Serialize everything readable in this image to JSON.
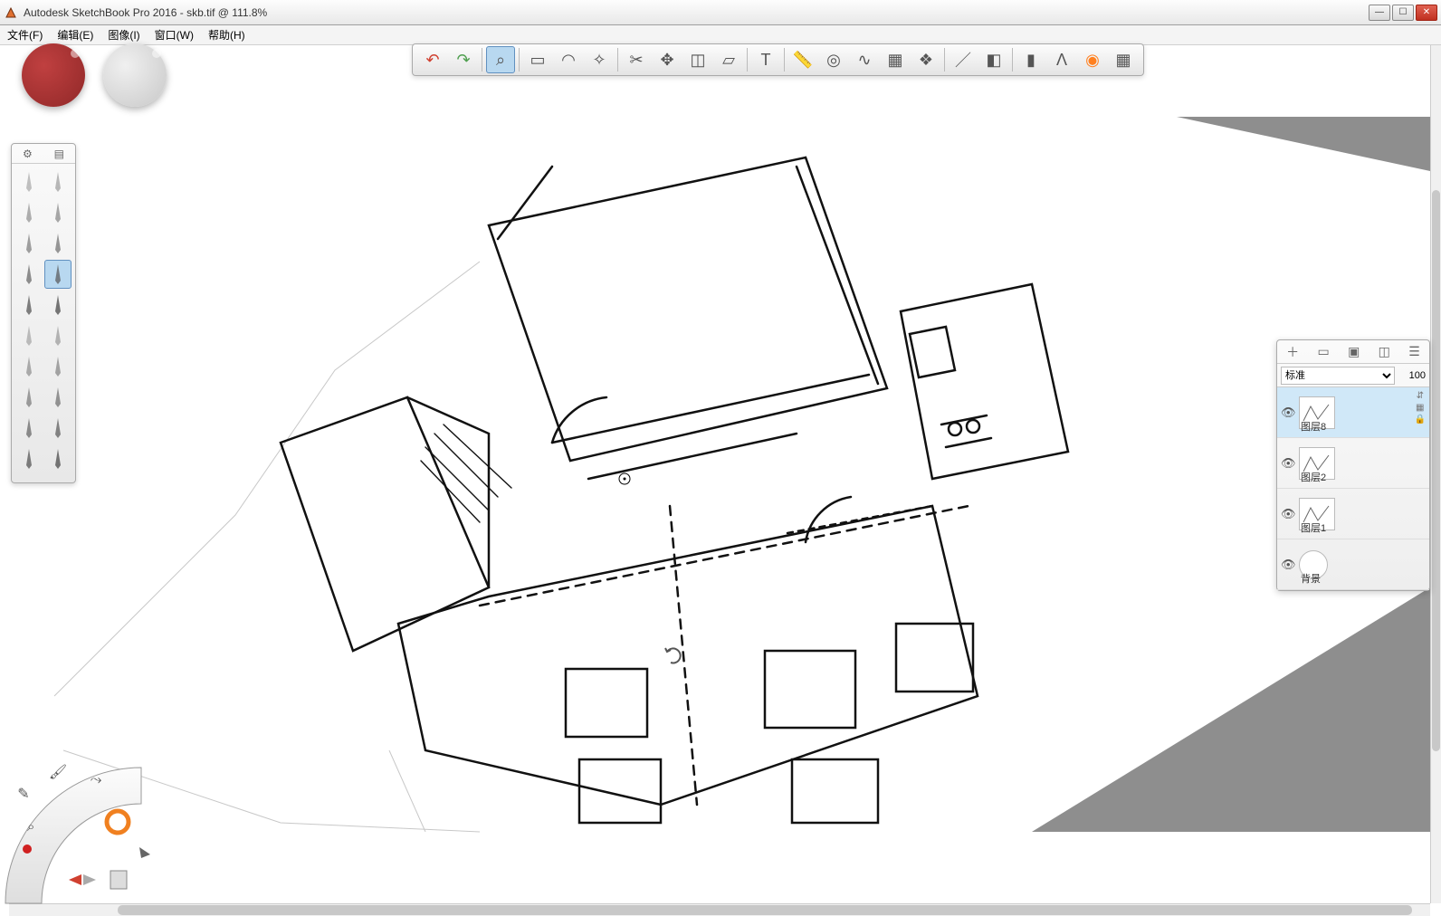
{
  "app": {
    "title": "Autodesk SketchBook Pro 2016 - skb.tif @ 111.8%",
    "icon_name": "sketchbook-app-icon"
  },
  "menus": [
    {
      "label": "文件(F)"
    },
    {
      "label": "编辑(E)"
    },
    {
      "label": "图像(I)"
    },
    {
      "label": "窗口(W)"
    },
    {
      "label": "帮助(H)"
    }
  ],
  "top_toolbar": [
    {
      "name": "undo",
      "icon": "↶",
      "color": "#d04030"
    },
    {
      "name": "redo",
      "icon": "↷",
      "color": "#50a050"
    },
    {
      "sep": true
    },
    {
      "name": "zoom",
      "icon": "⌕",
      "active": true
    },
    {
      "sep": true
    },
    {
      "name": "marquee-rect",
      "icon": "▭"
    },
    {
      "name": "marquee-lasso",
      "icon": "◠"
    },
    {
      "name": "marquee-magic",
      "icon": "✧"
    },
    {
      "sep": true
    },
    {
      "name": "crop",
      "icon": "✂"
    },
    {
      "name": "transform-move",
      "icon": "✥"
    },
    {
      "name": "transform-free",
      "icon": "◫"
    },
    {
      "name": "transform-distort",
      "icon": "▱"
    },
    {
      "sep": true
    },
    {
      "name": "text",
      "icon": "T"
    },
    {
      "sep": true
    },
    {
      "name": "ruler",
      "icon": "📏"
    },
    {
      "name": "ellipse-guide",
      "icon": "◎"
    },
    {
      "name": "french-curve",
      "icon": "∿"
    },
    {
      "name": "perspective",
      "icon": "▦"
    },
    {
      "name": "symmetry",
      "icon": "❖"
    },
    {
      "sep": true
    },
    {
      "name": "line-stroke",
      "icon": "／"
    },
    {
      "name": "shapes",
      "icon": "◧"
    },
    {
      "sep": true
    },
    {
      "name": "copic",
      "icon": "▮"
    },
    {
      "name": "brush-lib",
      "icon": "Λ"
    },
    {
      "name": "color-wheel",
      "icon": "◉",
      "color": "#ff8020"
    },
    {
      "name": "layers-toggle",
      "icon": "▦"
    }
  ],
  "brush_palette": {
    "rows": [
      [
        "pencil-1",
        "pencil-2"
      ],
      [
        "marker-1",
        "marker-2"
      ],
      [
        "pen-1",
        "pen-2"
      ],
      [
        "ink-1",
        "ink-2-sel"
      ],
      [
        "erase-1",
        "erase-2"
      ],
      [
        "air-1",
        "air-2"
      ],
      [
        "brush-1",
        "brush-2"
      ],
      [
        "paint-1",
        "paint-2"
      ],
      [
        "smudge-1",
        "smudge-2"
      ],
      [
        "flat-1",
        "flat-2"
      ]
    ],
    "selected_index": 7
  },
  "layers_panel": {
    "blend_mode": "标准",
    "opacity": "100",
    "buttons": [
      "add",
      "folder",
      "image",
      "fx",
      "menu"
    ],
    "layers": [
      {
        "name": "图层8",
        "visible": true,
        "selected": true
      },
      {
        "name": "图层2",
        "visible": true,
        "selected": false
      },
      {
        "name": "图层1",
        "visible": true,
        "selected": false
      },
      {
        "name": "背景",
        "visible": true,
        "selected": false,
        "is_bg": true
      }
    ]
  },
  "lagoon": {
    "tools": [
      "brush-size",
      "color-eyedrop",
      "zoom-mini",
      "record",
      "undo-mini",
      "redo-mini",
      "layers-mini",
      "pointer",
      "color-ring"
    ]
  },
  "colors": {
    "puck_primary": "#983030",
    "puck_secondary": "#d8d8d8",
    "accent": "#b8d8f0"
  }
}
